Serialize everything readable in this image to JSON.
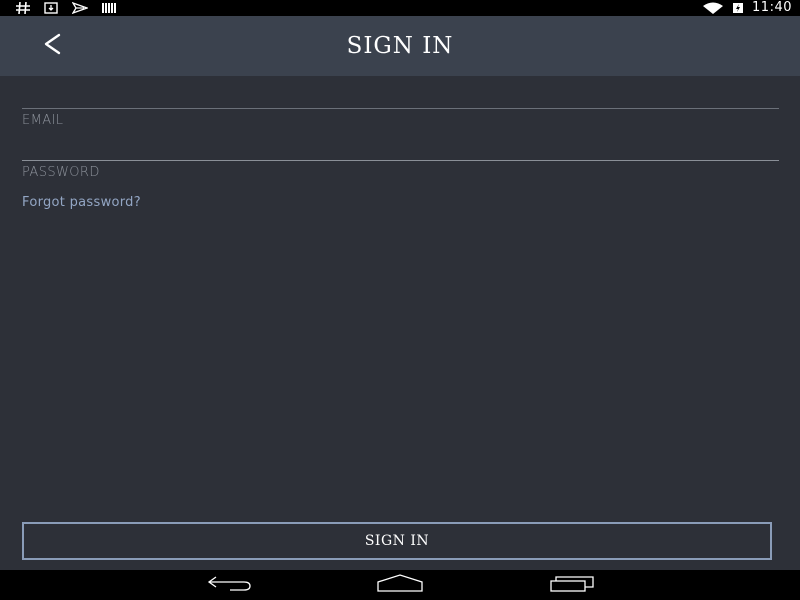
{
  "status_bar": {
    "time": "11:40",
    "left_icons": [
      "hash-icon",
      "download-icon",
      "send-icon",
      "barcode-icon"
    ],
    "right_icons": [
      "wifi-icon",
      "battery-charging-icon"
    ]
  },
  "header": {
    "title": "SIGN IN",
    "back_icon": "chevron-left-icon",
    "background": "#3b424e"
  },
  "form": {
    "email": {
      "label": "EMAIL",
      "value": ""
    },
    "password": {
      "label": "PASSWORD",
      "value": ""
    },
    "forgot_link": "Forgot password?"
  },
  "actions": {
    "sign_in_label": "SIGN IN"
  },
  "nav_bar": {
    "icons": [
      "back-icon",
      "home-icon",
      "recents-icon"
    ]
  },
  "colors": {
    "background": "#2d3038",
    "header": "#3b424e",
    "link": "#93a6c4",
    "button_border": "#8a9cb8"
  }
}
